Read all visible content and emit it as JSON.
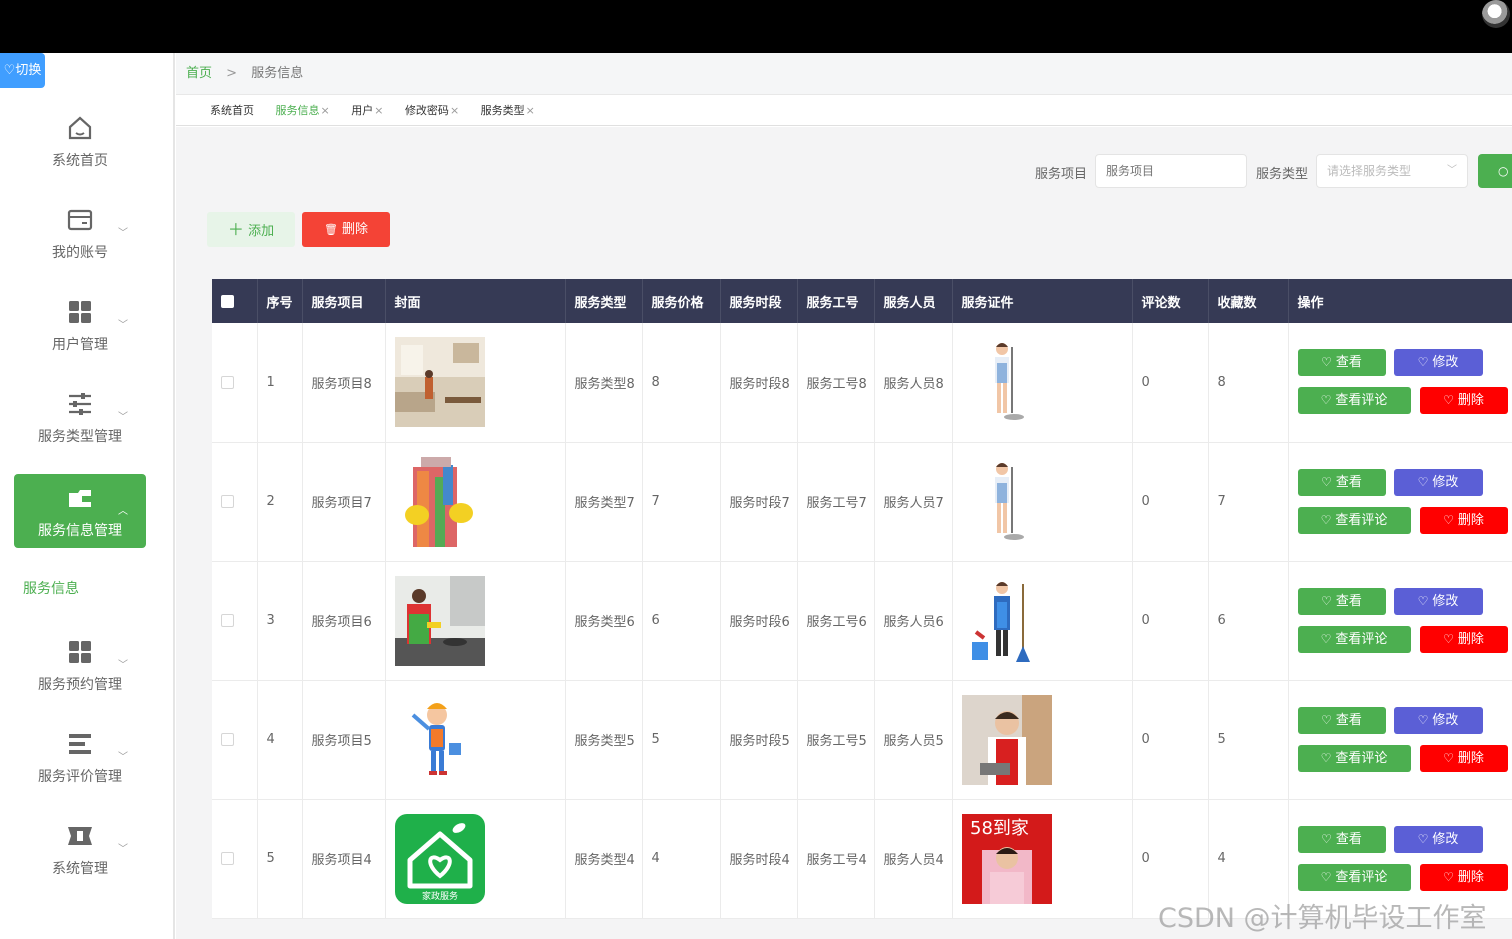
{
  "switch_label": "切换",
  "sidebar": {
    "items": [
      {
        "label": "系统首页",
        "icon": "home-icon"
      },
      {
        "label": "我的账号",
        "icon": "wallet-icon"
      },
      {
        "label": "用户管理",
        "icon": "grid-icon"
      },
      {
        "label": "服务类型管理",
        "icon": "sliders-icon"
      },
      {
        "label": "服务信息管理",
        "icon": "folder-icon"
      },
      {
        "label": "服务预约管理",
        "icon": "grid-icon"
      },
      {
        "label": "服务评价管理",
        "icon": "list-icon"
      },
      {
        "label": "系统管理",
        "icon": "gear-icon"
      }
    ],
    "sub_item": "服务信息",
    "active_color": "#4caf50"
  },
  "breadcrumb": {
    "home": "首页",
    "separator": ">",
    "current": "服务信息"
  },
  "tabs": [
    {
      "label": "系统首页",
      "closable": false
    },
    {
      "label": "服务信息",
      "closable": true,
      "active": true
    },
    {
      "label": "用户",
      "closable": true
    },
    {
      "label": "修改密码",
      "closable": true
    },
    {
      "label": "服务类型",
      "closable": true
    }
  ],
  "search": {
    "project_label": "服务项目",
    "project_placeholder": "服务项目",
    "type_label": "服务类型",
    "type_placeholder": "请选择服务类型"
  },
  "actions": {
    "add": "添加",
    "delete": "删除"
  },
  "table": {
    "headers": [
      "序号",
      "服务项目",
      "封面",
      "服务类型",
      "服务价格",
      "服务时段",
      "服务工号",
      "服务人员",
      "服务证件",
      "评论数",
      "收藏数",
      "操作"
    ],
    "ops": {
      "view": "查看",
      "edit": "修改",
      "comment": "查看评论",
      "remove": "删除"
    },
    "rows": [
      {
        "no": "1",
        "project": "服务项目8",
        "cover": "living-room-photo",
        "type": "服务类型8",
        "price": "8",
        "period": "服务时段8",
        "staff_no": "服务工号8",
        "staff": "服务人员8",
        "cert": "cleaner-illustration",
        "comments": "0",
        "favorites": "8"
      },
      {
        "no": "2",
        "project": "服务项目7",
        "cover": "cleaning-supplies-photo",
        "type": "服务类型7",
        "price": "7",
        "period": "服务时段7",
        "staff_no": "服务工号7",
        "staff": "服务人员7",
        "cert": "cleaner-illustration",
        "comments": "0",
        "favorites": "7"
      },
      {
        "no": "3",
        "project": "服务项目6",
        "cover": "kitchen-cleaning-photo",
        "type": "服务类型6",
        "price": "6",
        "period": "服务时段6",
        "staff_no": "服务工号6",
        "staff": "服务人员6",
        "cert": "maid-illustration",
        "comments": "0",
        "favorites": "6"
      },
      {
        "no": "4",
        "project": "服务项目5",
        "cover": "cartoon-cleaner",
        "type": "服务类型5",
        "price": "5",
        "period": "服务时段5",
        "staff_no": "服务工号5",
        "staff": "服务人员5",
        "cert": "housekeeper-photo",
        "comments": "0",
        "favorites": "5"
      },
      {
        "no": "5",
        "project": "服务项目4",
        "cover": "house-logo",
        "cover_text": "家政服务",
        "type": "服务类型4",
        "price": "4",
        "period": "服务时段4",
        "staff_no": "服务工号4",
        "staff": "服务人员4",
        "cert": "58-daojia-photo",
        "cert_text": "58到家",
        "comments": "0",
        "favorites": "4"
      }
    ]
  },
  "watermark": "CSDN @计算机毕设工作室"
}
